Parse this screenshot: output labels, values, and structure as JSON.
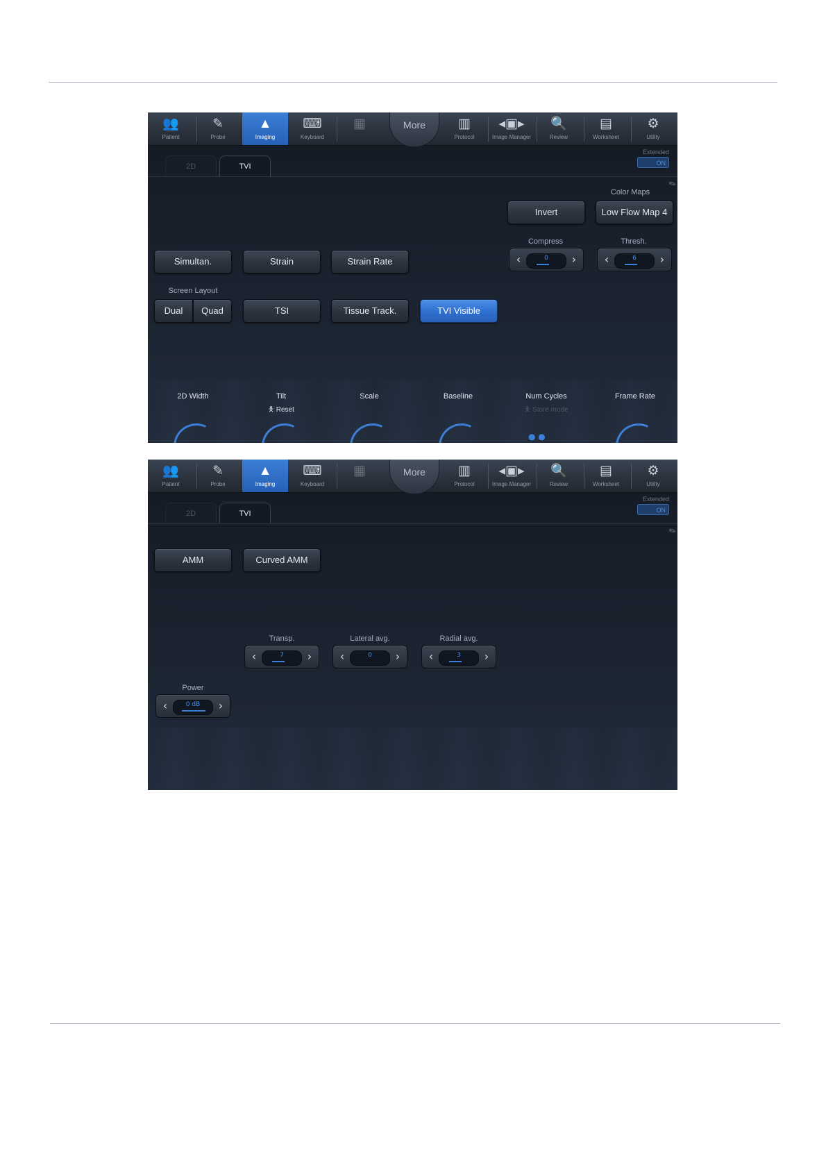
{
  "toolbar": {
    "items": [
      {
        "label": "Patient",
        "icon": "patient-icon"
      },
      {
        "label": "Probe",
        "icon": "probe-icon"
      },
      {
        "label": "Imaging",
        "icon": "imaging-icon"
      },
      {
        "label": "Keyboard",
        "icon": "keyboard-icon"
      },
      {
        "label": "",
        "icon": "image-icon"
      },
      {
        "label": "Protocol",
        "icon": "protocol-icon"
      },
      {
        "label": "Image Manager",
        "icon": "image-manager-icon"
      },
      {
        "label": "Review",
        "icon": "review-icon"
      },
      {
        "label": "Worksheet",
        "icon": "worksheet-icon"
      },
      {
        "label": "Utility",
        "icon": "utility-icon"
      }
    ],
    "more_label": "More"
  },
  "tabs": {
    "tab_2d": "2D",
    "tab_tvi": "TVI"
  },
  "extended": {
    "label": "Extended",
    "state": "ON"
  },
  "panel1": {
    "color_maps_label": "Color Maps",
    "invert": "Invert",
    "low_flow_map": "Low Flow Map 4",
    "compress_label": "Compress",
    "compress_value": "0",
    "thresh_label": "Thresh.",
    "thresh_value": "6",
    "simultan": "Simultan.",
    "strain": "Strain",
    "strain_rate": "Strain Rate",
    "screen_layout_label": "Screen Layout",
    "dual": "Dual",
    "quad": "Quad",
    "tsi": "TSI",
    "tissue_track": "Tissue Track.",
    "tvi_visible": "TVI Visible",
    "knobs": {
      "width": "2D Width",
      "tilt": "Tilt",
      "tilt_sub": "Reset",
      "scale": "Scale",
      "baseline": "Baseline",
      "num_cycles": "Num Cycles",
      "num_cycles_sub": "Store mode",
      "frame_rate": "Frame Rate"
    }
  },
  "panel2": {
    "amm": "AMM",
    "curved_amm": "Curved AMM",
    "transp_label": "Transp.",
    "transp_value": "7",
    "lateral_label": "Lateral avg.",
    "lateral_value": "0",
    "radial_label": "Radial avg.",
    "radial_value": "3",
    "power_label": "Power",
    "power_value": "0 dB"
  },
  "colors": {
    "accent": "#3d7fd6",
    "panel_bg": "#1b2330"
  }
}
